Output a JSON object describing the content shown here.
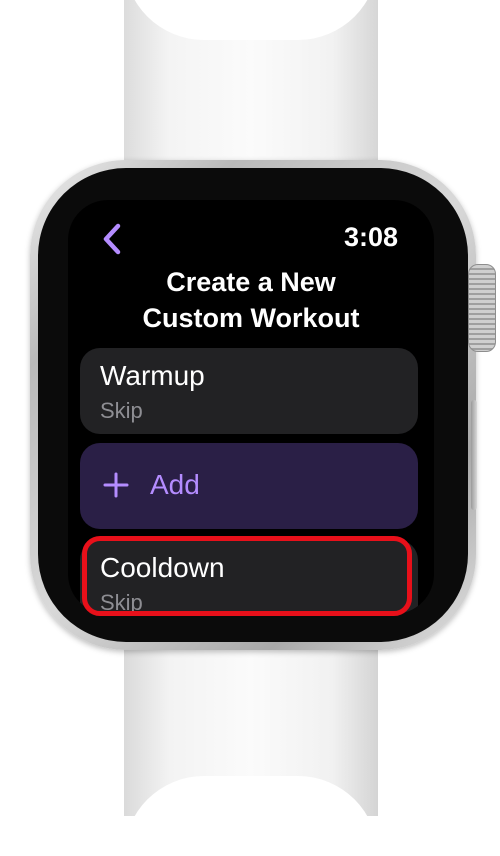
{
  "status_bar": {
    "time": "3:08"
  },
  "navigation": {
    "back_icon": "chevron-left-icon"
  },
  "header": {
    "title_line1": "Create a New",
    "title_line2": "Custom Workout"
  },
  "list": {
    "warmup": {
      "title": "Warmup",
      "subtitle": "Skip"
    },
    "add": {
      "label": "Add",
      "icon": "plus-icon"
    },
    "cooldown": {
      "title": "Cooldown",
      "subtitle": "Skip"
    }
  },
  "colors": {
    "accent": "#b48cff",
    "cell_background": "#222224",
    "add_background": "#2a1f46",
    "highlight": "#e8101a"
  }
}
